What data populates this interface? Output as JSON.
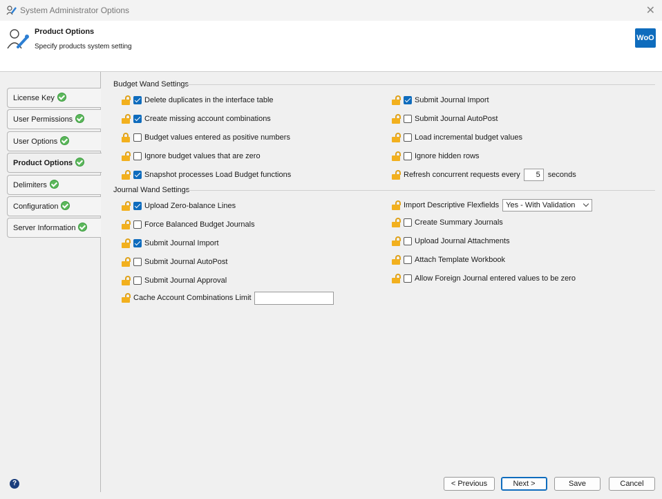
{
  "window": {
    "title": "System Administrator Options"
  },
  "header": {
    "title": "Product Options",
    "subtitle": "Specify products system setting",
    "logo": "WoO"
  },
  "tabs": [
    {
      "label": "License Key",
      "done": true
    },
    {
      "label": "User Permissions",
      "done": true
    },
    {
      "label": "User Options",
      "done": true
    },
    {
      "label": "Product Options",
      "done": true,
      "active": true
    },
    {
      "label": "Delimiters",
      "done": true
    },
    {
      "label": "Configuration",
      "done": true
    },
    {
      "label": "Server Information",
      "done": true
    }
  ],
  "budget": {
    "heading": "Budget Wand Settings",
    "left": [
      {
        "label": "Delete duplicates in the interface table",
        "checked": true
      },
      {
        "label": "Create missing account combinations",
        "checked": true
      },
      {
        "label": "Budget values entered as positive numbers",
        "checked": false
      },
      {
        "label": "Ignore budget values that are zero",
        "checked": false
      },
      {
        "label": "Snapshot processes Load Budget functions",
        "checked": true
      }
    ],
    "right": [
      {
        "label": "Submit Journal Import",
        "checked": true
      },
      {
        "label": "Submit Journal AutoPost",
        "checked": false
      },
      {
        "label": "Load incremental budget values",
        "checked": false
      },
      {
        "label": "Ignore hidden rows",
        "checked": false
      }
    ],
    "refresh": {
      "label": "Refresh concurrent requests every",
      "value": "5",
      "unit": "seconds"
    }
  },
  "journal": {
    "heading": "Journal Wand Settings",
    "left": [
      {
        "label": "Upload Zero-balance Lines",
        "checked": true
      },
      {
        "label": "Force Balanced Budget Journals",
        "checked": false
      },
      {
        "label": "Submit Journal Import",
        "checked": true
      },
      {
        "label": "Submit Journal AutoPost",
        "checked": false
      },
      {
        "label": "Submit Journal Approval",
        "checked": false
      }
    ],
    "cache": {
      "label": "Cache Account Combinations Limit",
      "value": ""
    },
    "flex": {
      "label": "Import Descriptive Flexfields",
      "value": "Yes - With Validation"
    },
    "right": [
      {
        "label": "Create Summary Journals",
        "checked": false
      },
      {
        "label": "Upload Journal Attachments",
        "checked": false
      },
      {
        "label": "Attach Template Workbook",
        "checked": false
      },
      {
        "label": "Allow Foreign Journal entered values to be zero",
        "checked": false
      }
    ]
  },
  "buttons": {
    "previous": "< Previous",
    "next": "Next >",
    "save": "Save",
    "cancel": "Cancel"
  },
  "colors": {
    "accent": "#0f6cbd",
    "lock": "#f2b01e",
    "badge": "#5cb85c"
  }
}
